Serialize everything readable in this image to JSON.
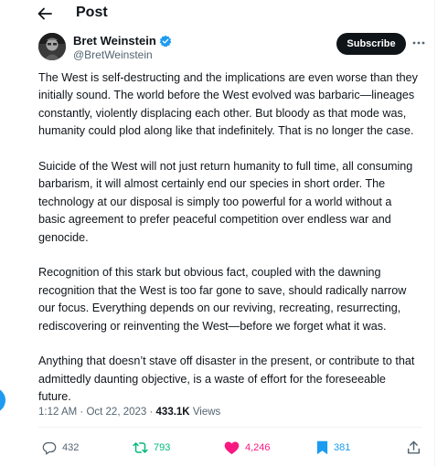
{
  "header": {
    "title": "Post"
  },
  "author": {
    "name": "Bret Weinstein",
    "handle": "@BretWeinstein",
    "verified": true,
    "subscribe_label": "Subscribe"
  },
  "tweet": {
    "paragraphs": [
      "The West is self-destructing and the implications are even worse than they initially sound. The world before the West evolved was barbaric—lineages constantly, violently displacing each other. But bloody as that mode was, humanity could plod along like that indefinitely. That is no longer the case.",
      "Suicide of the West will not just return humanity to full time, all consuming barbarism, it will almost certainly end our species in short order. The technology at our disposal is simply too powerful for a world without a basic agreement to prefer peaceful competition over endless war and genocide.",
      "Recognition of this stark but obvious fact, coupled with the dawning recognition that the West is too far gone to save, should radically narrow our focus. Everything depends on our reviving, recreating, resurrecting, rediscovering or reinventing the West—before we forget what it was.",
      "Anything that doesn’t stave off disaster in the present, or contribute to that admittedly daunting objective, is a waste of effort for the foreseeable future."
    ],
    "time": "1:12 AM",
    "date": "Oct 22, 2023",
    "views_count": "433.1K",
    "views_label": "Views"
  },
  "actions": {
    "replies": "432",
    "reposts": "793",
    "likes": "4,246",
    "bookmarks": "381"
  },
  "colors": {
    "accent": "#1d9bf0",
    "repost": "#00ba7c",
    "like": "#f91880",
    "text": "#0f1419",
    "muted": "#536471"
  },
  "icons": [
    "back-arrow-icon",
    "verified-badge-icon",
    "more-icon",
    "reply-icon",
    "repost-icon",
    "like-icon",
    "bookmark-icon",
    "share-icon"
  ]
}
